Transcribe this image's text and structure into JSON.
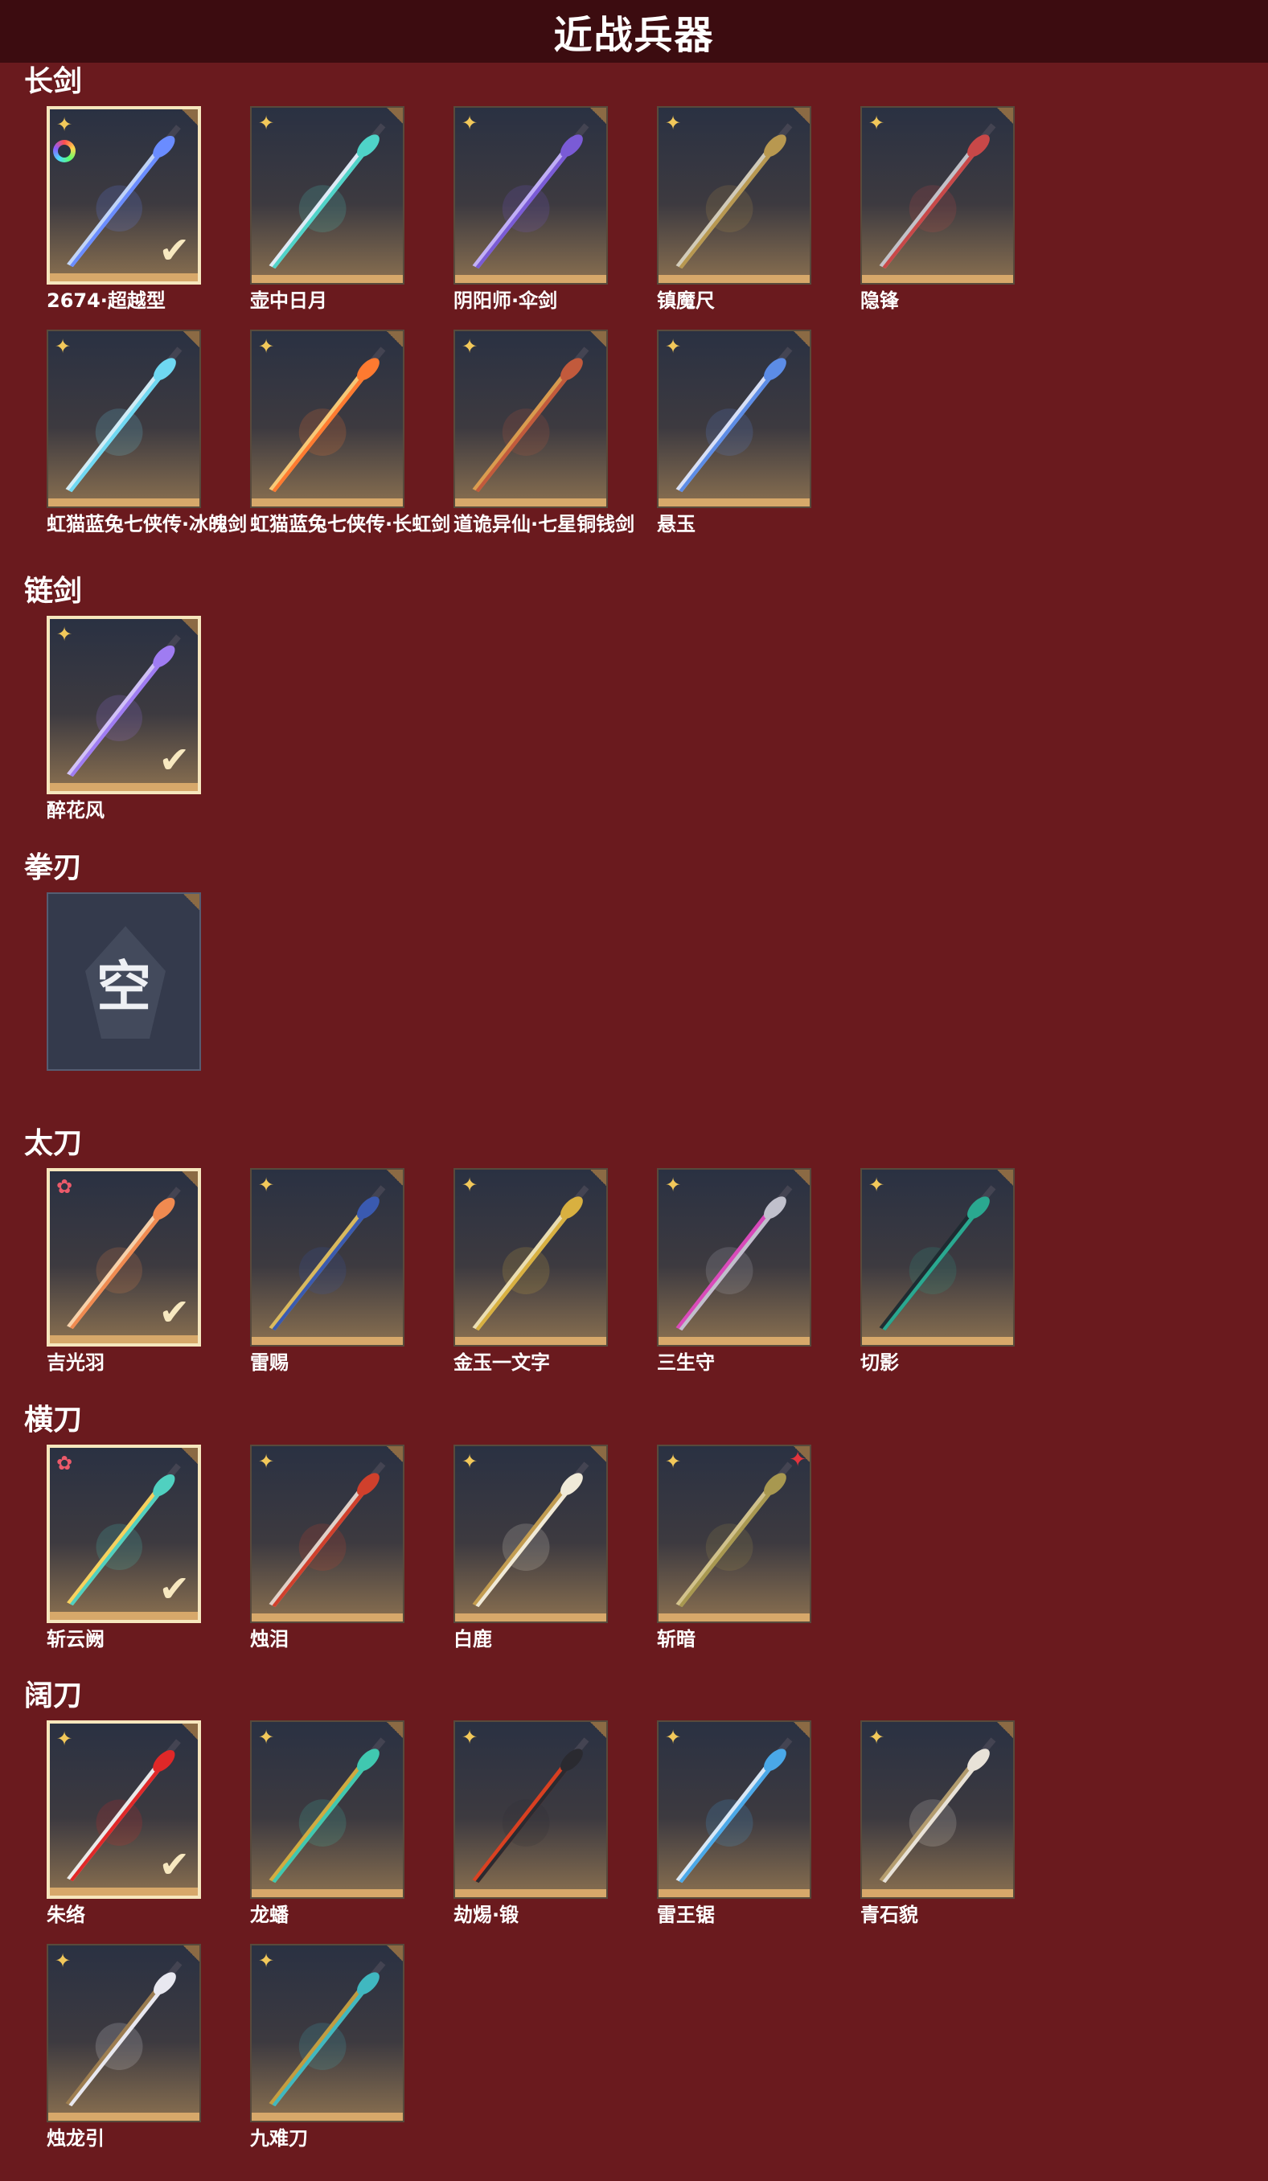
{
  "title": "近战兵器",
  "icons": {
    "rarity_gold": "four-point-star-icon",
    "rarity_red": "flower-star-icon",
    "rarity_rainbow": "rainbow-ring-icon",
    "selected": "checkmark-icon",
    "empty": "empty-slot-icon"
  },
  "colors": {
    "background": "#6a1a1e",
    "header": "#3c0c10",
    "card_footer": "#d7a86a",
    "selected_border": "#f6e6bd"
  },
  "sections": [
    {
      "title": "长剑",
      "items": [
        {
          "name": "2674·超越型",
          "rarity": "gold",
          "selected": true,
          "extra": "rainbow",
          "colors": [
            "#6a8cff",
            "#c7dbff"
          ]
        },
        {
          "name": "壶中日月",
          "rarity": "gold",
          "selected": false,
          "colors": [
            "#4fd3c8",
            "#e6f2ff"
          ]
        },
        {
          "name": "阴阳师·伞剑",
          "rarity": "gold",
          "selected": false,
          "colors": [
            "#7a5bd6",
            "#c7b5ff"
          ]
        },
        {
          "name": "镇魔尺",
          "rarity": "gold",
          "selected": false,
          "colors": [
            "#b89850",
            "#d8d2c0"
          ]
        },
        {
          "name": "隐锋",
          "rarity": "gold",
          "selected": false,
          "colors": [
            "#c84848",
            "#c8c8d0"
          ]
        },
        {
          "name": "虹猫蓝兔七侠传·冰魄剑",
          "rarity": "gold",
          "selected": false,
          "colors": [
            "#6fd8f2",
            "#d8f4ff"
          ]
        },
        {
          "name": "虹猫蓝兔七侠传·长虹剑",
          "rarity": "gold",
          "selected": false,
          "colors": [
            "#ff7a30",
            "#ffd07a"
          ]
        },
        {
          "name": "道诡异仙·七星铜钱剑",
          "rarity": "gold",
          "selected": false,
          "colors": [
            "#c25a3c",
            "#e0a050"
          ]
        },
        {
          "name": "悬玉",
          "rarity": "gold",
          "selected": false,
          "colors": [
            "#5c8ce6",
            "#dfe8ff"
          ]
        }
      ]
    },
    {
      "title": "链剑",
      "items": [
        {
          "name": "醉花风",
          "rarity": "gold",
          "selected": true,
          "colors": [
            "#9f7cf2",
            "#d8c8ff"
          ]
        }
      ]
    },
    {
      "title": "拳刃",
      "items": [
        {
          "name": "",
          "empty": true,
          "empty_label": "空"
        }
      ]
    },
    {
      "title": "太刀",
      "items": [
        {
          "name": "吉光羽",
          "rarity": "red",
          "selected": true,
          "colors": [
            "#f08a50",
            "#ffd8b0"
          ]
        },
        {
          "name": "雷赐",
          "rarity": "gold",
          "selected": false,
          "colors": [
            "#3a5ab0",
            "#e0c060"
          ]
        },
        {
          "name": "金玉一文字",
          "rarity": "gold",
          "selected": false,
          "colors": [
            "#d8b040",
            "#f2e6b8"
          ]
        },
        {
          "name": "三生守",
          "rarity": "gold",
          "selected": false,
          "colors": [
            "#c0c0cc",
            "#e04ac0"
          ]
        },
        {
          "name": "切影",
          "rarity": "gold",
          "selected": false,
          "colors": [
            "#2aa890",
            "#1c2a30"
          ]
        }
      ]
    },
    {
      "title": "横刀",
      "items": [
        {
          "name": "斩云阙",
          "rarity": "red",
          "selected": true,
          "colors": [
            "#50d0c0",
            "#ffd860"
          ]
        },
        {
          "name": "烛泪",
          "rarity": "gold",
          "selected": false,
          "colors": [
            "#d0402c",
            "#e8d8d0"
          ]
        },
        {
          "name": "白鹿",
          "rarity": "gold",
          "selected": false,
          "colors": [
            "#f0ead8",
            "#c8a050"
          ]
        },
        {
          "name": "斩暗",
          "rarity": "gold",
          "selected": false,
          "extra": "red-badge",
          "colors": [
            "#a89850",
            "#d8c890"
          ]
        }
      ]
    },
    {
      "title": "阔刀",
      "items": [
        {
          "name": "朱络",
          "rarity": "gold",
          "selected": true,
          "colors": [
            "#e02828",
            "#f2f2f2"
          ]
        },
        {
          "name": "龙蟠",
          "rarity": "gold",
          "selected": false,
          "colors": [
            "#40c8b0",
            "#d8b040"
          ]
        },
        {
          "name": "劫焬·锻",
          "rarity": "gold",
          "selected": false,
          "colors": [
            "#2a2a30",
            "#e04020"
          ]
        },
        {
          "name": "雷王锯",
          "rarity": "gold",
          "selected": false,
          "colors": [
            "#4aa8e8",
            "#e0f0ff"
          ]
        },
        {
          "name": "青石貌",
          "rarity": "gold",
          "selected": false,
          "colors": [
            "#e8e2d8",
            "#b8a070"
          ]
        },
        {
          "name": "烛龙引",
          "rarity": "gold",
          "selected": false,
          "colors": [
            "#e8e8f0",
            "#a08050"
          ]
        },
        {
          "name": "九难刀",
          "rarity": "gold",
          "selected": false,
          "colors": [
            "#40b8c0",
            "#c8a040"
          ]
        }
      ]
    }
  ]
}
